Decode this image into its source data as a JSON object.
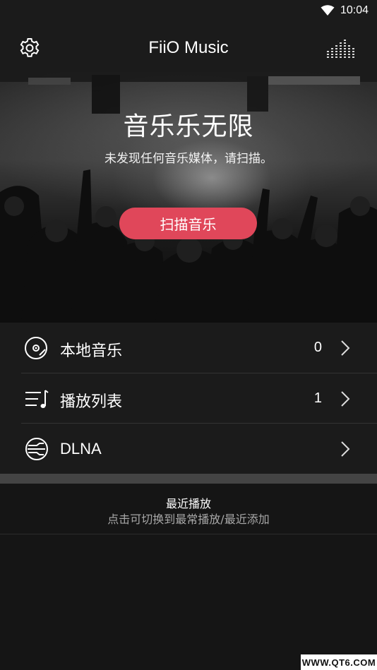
{
  "status_bar": {
    "time": "10:04",
    "icons": [
      "wifi-icon"
    ]
  },
  "app_bar": {
    "title": "FiiO Music",
    "left_icon": "gear-icon",
    "right_icon": "equalizer-icon"
  },
  "hero": {
    "title": "音乐乐无限",
    "subtitle": "未发现任何音乐媒体，请扫描。",
    "scan_button": "扫描音乐",
    "accent_color": "#e0475a"
  },
  "menu": {
    "items": [
      {
        "label": "本地音乐",
        "count": "0",
        "icon": "vinyl-disc-icon"
      },
      {
        "label": "播放列表",
        "count": "1",
        "icon": "playlist-icon"
      },
      {
        "label": "DLNA",
        "count": "",
        "icon": "dlna-icon"
      }
    ]
  },
  "recent": {
    "title": "最近播放",
    "subtitle": "点击可切换到最常播放/最近添加"
  },
  "watermark": "WWW.QT6.COM"
}
